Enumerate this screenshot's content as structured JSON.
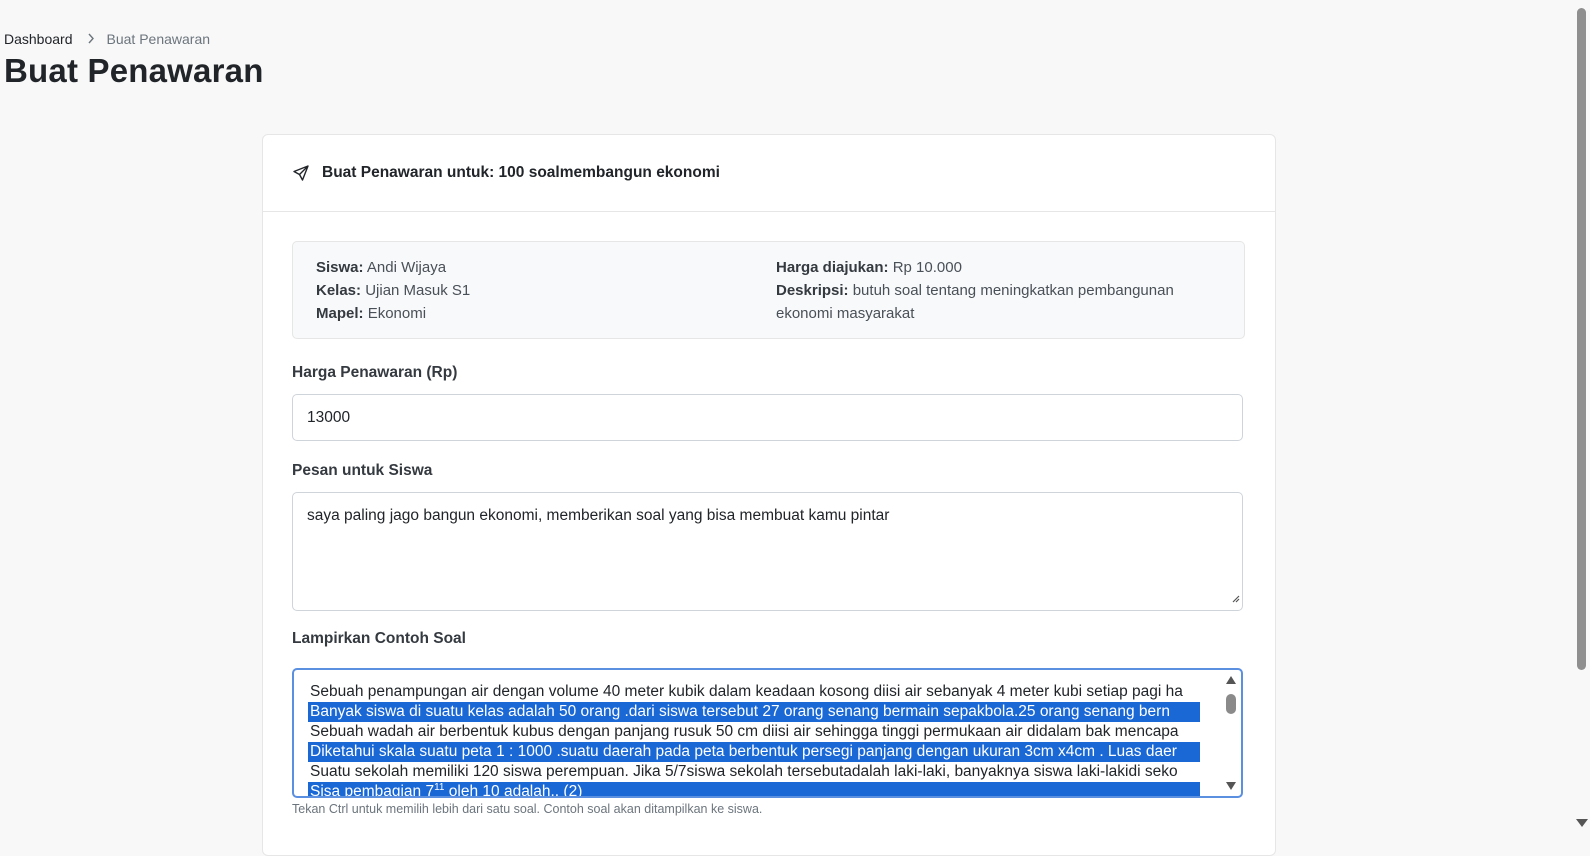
{
  "breadcrumb": {
    "home": "Dashboard",
    "current": "Buat Penawaran"
  },
  "page_title": "Buat Penawaran",
  "card": {
    "header": "Buat Penawaran untuk: 100 soalmembangun ekonomi",
    "header_icon": "send-icon"
  },
  "request": {
    "siswa_label": "Siswa:",
    "siswa": "Andi Wijaya",
    "kelas_label": "Kelas:",
    "kelas": "Ujian Masuk S1",
    "mapel_label": "Mapel:",
    "mapel": "Ekonomi",
    "harga_label": "Harga diajukan:",
    "harga": "Rp 10.000",
    "deskripsi_label": "Deskripsi:",
    "deskripsi": "butuh soal tentang meningkatkan pembangunan ekonomi masyarakat"
  },
  "form": {
    "harga_label": "Harga Penawaran (Rp)",
    "harga_value": "13000",
    "pesan_label": "Pesan untuk Siswa",
    "pesan_value": "saya paling jago bangun ekonomi, memberikan soal yang bisa membuat kamu pintar",
    "lampiran_label": "Lampirkan Contoh Soal",
    "lampiran_help": "Tekan Ctrl untuk memilih lebih dari satu soal. Contoh soal akan ditampilkan ke siswa.",
    "options": [
      {
        "text": "Sebuah penampungan air dengan volume 40 meter kubik dalam keadaan kosong diisi air sebanyak 4 meter kubi setiap pagi ha",
        "selected": false
      },
      {
        "text": "Banyak siswa di suatu kelas adalah 50 orang .dari siswa tersebut 27 orang senang bermain sepakbola.25 orang senang bern",
        "selected": true
      },
      {
        "text": "Sebuah wadah air berbentuk kubus dengan panjang rusuk 50 cm diisi air sehingga tinggi permukaan air didalam bak mencapa",
        "selected": false
      },
      {
        "text": "Diketahui skala suatu peta 1 : 1000 .suatu daerah pada peta berbentuk persegi panjang dengan ukuran 3cm x4cm . Luas daer",
        "selected": true
      },
      {
        "text": "Suatu sekolah memiliki 120 siswa perempuan. Jika 5/7siswa sekolah tersebutadalah laki-laki, banyaknya siswa laki-lakidi seko",
        "selected": false
      },
      {
        "text_before": "Sisa pembagian 7",
        "text_sup": "11",
        "text_after": " oleh 10 adalah.. (2)",
        "selected": true
      }
    ]
  }
}
